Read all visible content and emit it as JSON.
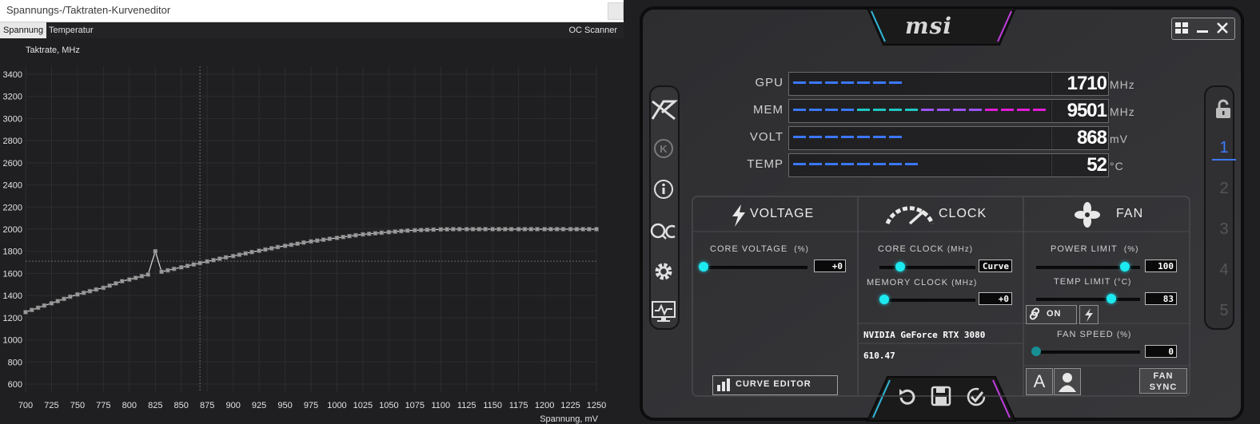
{
  "curve_editor": {
    "title": "Spannungs-/Taktraten-Kurveneditor",
    "tabs": [
      {
        "label": "Spannung",
        "active": true
      },
      {
        "label": "Temperatur",
        "active": false
      }
    ],
    "oc_scanner_label": "OC Scanner"
  },
  "chart_data": {
    "type": "line",
    "ylabel": "Taktrate, MHz",
    "xlabel": "Spannung, mV",
    "xlim": [
      700,
      1250
    ],
    "ylim": [
      600,
      3400
    ],
    "x_ticks": [
      700,
      725,
      750,
      775,
      800,
      825,
      850,
      875,
      900,
      925,
      950,
      975,
      1000,
      1025,
      1050,
      1075,
      1100,
      1125,
      1150,
      1175,
      1200,
      1225,
      1250
    ],
    "y_ticks": [
      600,
      800,
      1000,
      1200,
      1400,
      1600,
      1800,
      2000,
      2200,
      2400,
      2600,
      2800,
      3000,
      3200,
      3400
    ],
    "crosshair": {
      "x": 868,
      "y": 1710
    },
    "series": [
      {
        "x": [
          700,
          706,
          712,
          718,
          725,
          731,
          737,
          743,
          750,
          756,
          762,
          768,
          775,
          781,
          787,
          793,
          800,
          806,
          812,
          818,
          825,
          831,
          837,
          843,
          850,
          856,
          862,
          868,
          875,
          881,
          887,
          893,
          900,
          906,
          912,
          918,
          925,
          931,
          937,
          943,
          950,
          956,
          962,
          968,
          975,
          981,
          987,
          993,
          1000,
          1006,
          1012,
          1018,
          1025,
          1031,
          1037,
          1043,
          1050,
          1056,
          1062,
          1068,
          1075,
          1081,
          1087,
          1093,
          1100,
          1106,
          1112,
          1118,
          1125,
          1131,
          1137,
          1143,
          1150,
          1156,
          1162,
          1168,
          1175,
          1181,
          1187,
          1193,
          1200,
          1206,
          1212,
          1218,
          1225,
          1231,
          1237,
          1243,
          1250
        ],
        "y": [
          1250,
          1270,
          1290,
          1310,
          1330,
          1350,
          1370,
          1390,
          1410,
          1425,
          1440,
          1455,
          1470,
          1490,
          1510,
          1530,
          1545,
          1560,
          1575,
          1590,
          1800,
          1615,
          1628,
          1641,
          1655,
          1668,
          1681,
          1694,
          1708,
          1720,
          1733,
          1745,
          1757,
          1769,
          1781,
          1793,
          1805,
          1816,
          1827,
          1838,
          1849,
          1859,
          1869,
          1879,
          1889,
          1897,
          1905,
          1913,
          1921,
          1929,
          1937,
          1945,
          1953,
          1958,
          1963,
          1968,
          1973,
          1978,
          1983,
          1987,
          1990,
          1992,
          1994,
          1996,
          1998,
          1999,
          2000,
          2000,
          2000,
          2000,
          2000,
          2000,
          2000,
          2000,
          2000,
          2000,
          2000,
          2000,
          2000,
          2000,
          2000,
          2000,
          2000,
          2000,
          2000,
          2000,
          2000,
          2000,
          2000
        ]
      }
    ]
  },
  "afterburner": {
    "logo": "msi",
    "monitors": [
      {
        "label": "GPU",
        "value": "1710",
        "unit": "MHz",
        "fill": 0.46,
        "colors": [
          "#3a78ff",
          "#3a78ff",
          "#1fc7c0",
          "#1fc7c0"
        ]
      },
      {
        "label": "MEM",
        "value": "9501",
        "unit": "MHz",
        "fill": 0.98,
        "colors": [
          "#3a78ff",
          "#1fc7c0",
          "#9b55f5",
          "#e31bd7"
        ]
      },
      {
        "label": "VOLT",
        "value": "868",
        "unit": "mV",
        "fill": 0.44,
        "colors": [
          "#3a78ff",
          "#3a78ff",
          "#3a78ff",
          "#3a78ff"
        ]
      },
      {
        "label": "TEMP",
        "value": "52",
        "unit": "°C",
        "fill": 0.52,
        "colors": [
          "#3a78ff",
          "#3a78ff",
          "#3a9be8",
          "#2ab9d6"
        ]
      }
    ],
    "sections": {
      "voltage": "VOLTAGE",
      "clock": "CLOCK",
      "fan": "FAN"
    },
    "core_voltage": {
      "label": "CORE VOLTAGE",
      "unit": "(%)",
      "value": "+0",
      "level": 0.0
    },
    "core_clock": {
      "label": "CORE CLOCK",
      "unit": "(MHz)",
      "value": "Curve",
      "level": 0.22
    },
    "memory_clock": {
      "label": "MEMORY CLOCK",
      "unit": "(MHz)",
      "value": "+0",
      "level": 0.05
    },
    "power_limit": {
      "label": "POWER LIMIT",
      "unit": "(%)",
      "value": "100",
      "level": 0.85
    },
    "temp_limit": {
      "label": "TEMP LIMIT",
      "unit": "(°C)",
      "value": "83",
      "level": 0.72
    },
    "link_on_label": "ON",
    "fan_speed": {
      "label": "FAN SPEED",
      "unit": "(%)",
      "value": "0",
      "level": 0.0
    },
    "gpu_name": "NVIDIA GeForce RTX 3080",
    "driver": "610.47",
    "curve_editor_button": "CURVE EDITOR",
    "fan_sync_button": [
      "FAN",
      "SYNC"
    ],
    "auto_label": "A",
    "profiles": [
      "1",
      "2",
      "3",
      "4",
      "5"
    ],
    "active_profile": "1"
  }
}
